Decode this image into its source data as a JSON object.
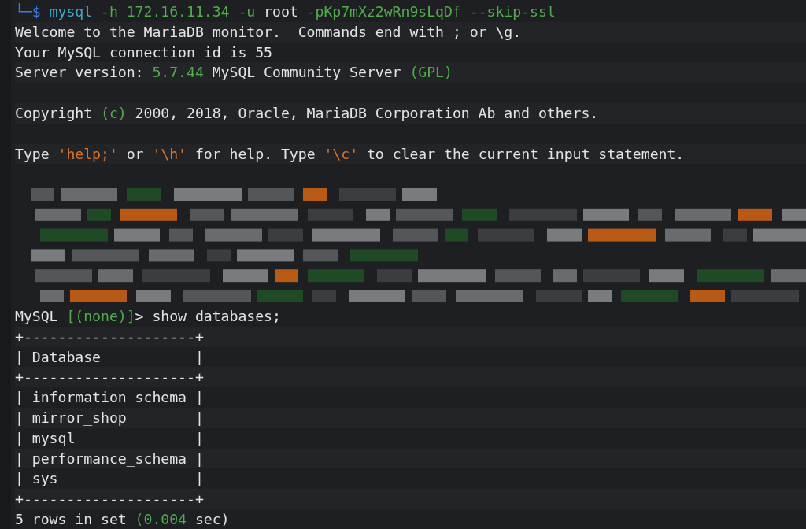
{
  "terminal": {
    "lines": [
      {
        "kind": "text",
        "segments": [
          {
            "text": "└─$ ",
            "kind": "prompt"
          },
          {
            "text": "mysql",
            "kind": "command"
          },
          {
            "text": " -h 172.16.11.34 -u",
            "kind": "arg"
          },
          {
            "text": " root ",
            "kind": "plain"
          },
          {
            "text": "-pKp7mXz2wRn9sLqDf --skip-ssl",
            "kind": "arg"
          }
        ]
      },
      {
        "kind": "text",
        "segments": [
          {
            "text": "Welcome to the MariaDB monitor.  Commands end with ; or \\g.",
            "kind": "plain"
          }
        ]
      },
      {
        "kind": "text",
        "segments": [
          {
            "text": "Your MySQL connection id is 55",
            "kind": "plain"
          }
        ]
      },
      {
        "kind": "text",
        "segments": [
          {
            "text": "Server version: ",
            "kind": "plain"
          },
          {
            "text": "5.7.44",
            "kind": "arg"
          },
          {
            "text": " MySQL Community Server ",
            "kind": "plain"
          },
          {
            "text": "(GPL)",
            "kind": "arg"
          }
        ]
      },
      {
        "kind": "blank"
      },
      {
        "kind": "text",
        "segments": [
          {
            "text": "Copyright ",
            "kind": "plain"
          },
          {
            "text": "(c)",
            "kind": "arg"
          },
          {
            "text": " 2000, 2018, Oracle, MariaDB Corporation Ab and others.",
            "kind": "plain"
          }
        ]
      },
      {
        "kind": "blank"
      },
      {
        "kind": "text",
        "segments": [
          {
            "text": "Type ",
            "kind": "plain"
          },
          {
            "text": "'help;'",
            "kind": "string"
          },
          {
            "text": " or ",
            "kind": "plain"
          },
          {
            "text": "'\\h'",
            "kind": "string"
          },
          {
            "text": " for help. Type ",
            "kind": "plain"
          },
          {
            "text": "'\\c'",
            "kind": "string"
          },
          {
            "text": " to clear the current input statement.",
            "kind": "plain"
          }
        ]
      },
      {
        "kind": "blank"
      },
      {
        "kind": "redacted"
      },
      {
        "kind": "text",
        "segments": [
          {
            "text": "MySQL ",
            "kind": "plain"
          },
          {
            "text": "[(none)]",
            "kind": "arg"
          },
          {
            "text": "> show databases;",
            "kind": "plain"
          }
        ]
      },
      {
        "kind": "text",
        "segments": [
          {
            "text": "+--------------------+",
            "kind": "plain"
          }
        ]
      },
      {
        "kind": "text",
        "segments": [
          {
            "text": "| Database           |",
            "kind": "plain"
          }
        ]
      },
      {
        "kind": "text",
        "segments": [
          {
            "text": "+--------------------+",
            "kind": "plain"
          }
        ]
      },
      {
        "kind": "text",
        "segments": [
          {
            "text": "| information_schema |",
            "kind": "plain"
          }
        ]
      },
      {
        "kind": "text",
        "segments": [
          {
            "text": "| mirror_shop        |",
            "kind": "plain"
          }
        ]
      },
      {
        "kind": "text",
        "segments": [
          {
            "text": "| mysql              |",
            "kind": "plain"
          }
        ]
      },
      {
        "kind": "text",
        "segments": [
          {
            "text": "| performance_schema |",
            "kind": "plain"
          }
        ]
      },
      {
        "kind": "text",
        "segments": [
          {
            "text": "| sys                |",
            "kind": "plain"
          }
        ]
      },
      {
        "kind": "text",
        "segments": [
          {
            "text": "+--------------------+",
            "kind": "plain"
          }
        ]
      },
      {
        "kind": "text",
        "segments": [
          {
            "text": "5 rows in set ",
            "kind": "plain"
          },
          {
            "text": "(0.004",
            "kind": "arg"
          },
          {
            "text": " sec)",
            "kind": "plain"
          }
        ]
      }
    ]
  }
}
